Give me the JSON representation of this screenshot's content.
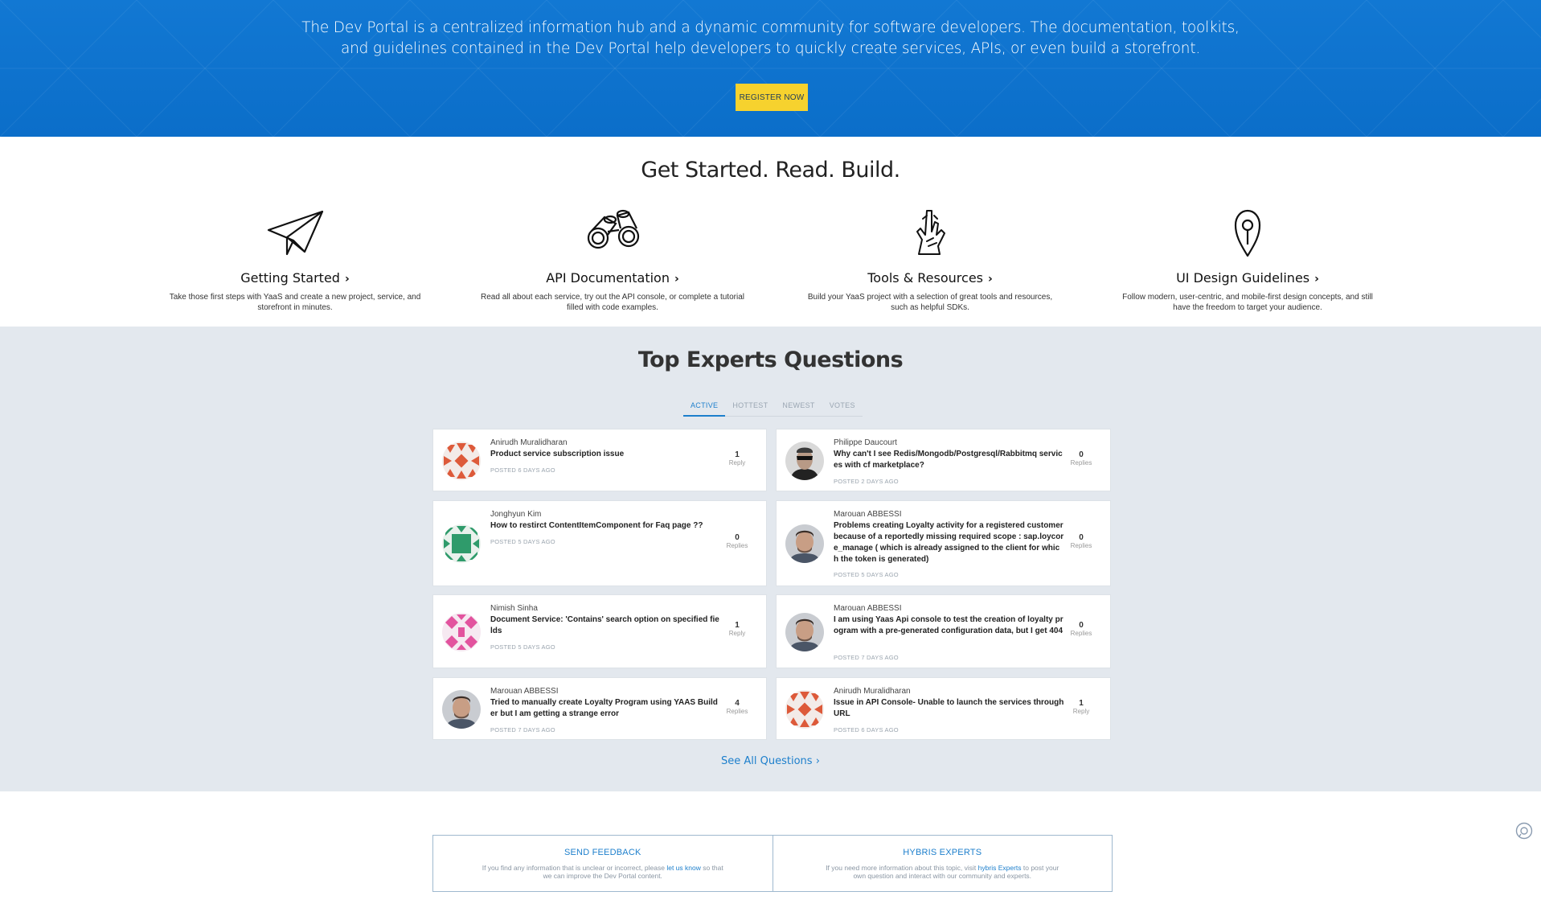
{
  "hero": {
    "description": "The Dev Portal is a centralized information hub and a dynamic community for software developers. The documentation, toolkits, and guidelines contained in the Dev Portal help developers to quickly create services, APIs, or even build a storefront.",
    "register_label": "REGISTER NOW",
    "bg_color": "#0b6ec9",
    "button_color": "#f6d22e"
  },
  "get_started": {
    "title": "Get Started. Read. Build.",
    "features": [
      {
        "icon": "paper-plane-icon",
        "title": "Getting Started",
        "desc": "Take those first steps with YaaS and create a new project, service, and storefront in minutes."
      },
      {
        "icon": "binoculars-icon",
        "title": "API Documentation",
        "desc": "Read all about each service, try out the API console, or complete a tutorial filled with code examples."
      },
      {
        "icon": "hand-tools-icon",
        "title": "Tools & Resources",
        "desc": "Build your YaaS project with a selection of great tools and resources, such as helpful SDKs."
      },
      {
        "icon": "map-pin-icon",
        "title": "UI Design Guidelines",
        "desc": "Follow modern, user-centric, and mobile-first design concepts, and still have the freedom to target your audience."
      }
    ]
  },
  "questions": {
    "title": "Top Experts Questions",
    "tabs": [
      "ACTIVE",
      "HOTTEST",
      "NEWEST",
      "VOTES"
    ],
    "active_tab": "ACTIVE",
    "items": [
      {
        "author": "Anirudh Muralidharan",
        "title": "Product service subscription issue",
        "posted": "POSTED 6 DAYS AGO",
        "count": "1",
        "count_label": "Reply",
        "avatar": "identicon-orange"
      },
      {
        "author": "Philippe Daucourt",
        "title": "Why can't I see Redis/Mongodb/Postgresql/Rabbitmq services with cf marketplace?",
        "posted": "POSTED 2 DAYS AGO",
        "count": "0",
        "count_label": "Replies",
        "avatar": "photo-sunglasses"
      },
      {
        "author": "Jonghyun Kim",
        "title": "How to restirct ContentItemComponent for Faq page ??",
        "posted": "POSTED 5 DAYS AGO",
        "count": "0",
        "count_label": "Replies",
        "avatar": "identicon-green"
      },
      {
        "author": "Marouan ABBESSI",
        "title": "Problems creating Loyalty activity for a registered customer because of a reportedly missing required scope : sap.loycore_manage ( which is already assigned to the client for which the token is generated)",
        "posted": "POSTED 5 DAYS AGO",
        "count": "0",
        "count_label": "Replies",
        "avatar": "photo-man"
      },
      {
        "author": "Nimish Sinha",
        "title": "Document Service: 'Contains' search option on specified fields",
        "posted": "POSTED 5 DAYS AGO",
        "count": "1",
        "count_label": "Reply",
        "avatar": "identicon-pink"
      },
      {
        "author": "Marouan ABBESSI",
        "title": "I am using Yaas Api console to test the creation of loyalty program with a pre-generated configuration data, but I get 404",
        "posted": "POSTED 7 DAYS AGO",
        "count": "0",
        "count_label": "Replies",
        "avatar": "photo-man"
      },
      {
        "author": "Marouan ABBESSI",
        "title": "Tried to manually create Loyalty Program using YAAS Builder but I am getting a strange error",
        "posted": "POSTED 7 DAYS AGO",
        "count": "4",
        "count_label": "Replies",
        "avatar": "photo-man"
      },
      {
        "author": "Anirudh Muralidharan",
        "title": "Issue in API Console- Unable to launch the services through URL",
        "posted": "POSTED 6 DAYS AGO",
        "count": "1",
        "count_label": "Reply",
        "avatar": "identicon-orange"
      }
    ],
    "see_all": "See All Questions"
  },
  "footer": {
    "feedback": {
      "title": "SEND FEEDBACK",
      "text_before": "If you find any information that is unclear or incorrect, please ",
      "link": "let us know",
      "text_after": " so that we can improve the Dev Portal content."
    },
    "experts": {
      "title": "HYBRIS EXPERTS",
      "text_before": "If you need more information about this topic, visit ",
      "link": "hybris Experts",
      "text_after": " to post your own question and interact with our community and experts."
    }
  },
  "accent_color": "#1d7fcc"
}
